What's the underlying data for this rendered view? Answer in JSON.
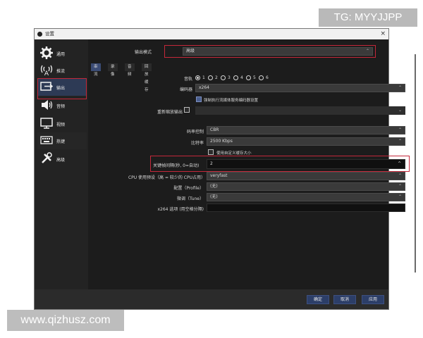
{
  "watermarks": {
    "top": "TG: MYYJJPP",
    "bottom": "www.qizhusz.com"
  },
  "window": {
    "title": "设置",
    "close_glyph": "×"
  },
  "sidebar": {
    "items": [
      {
        "label": "通用",
        "icon": "gear-icon"
      },
      {
        "label": "推流",
        "icon": "broadcast-icon"
      },
      {
        "label": "输出",
        "icon": "output-icon"
      },
      {
        "label": "音频",
        "icon": "speaker-icon"
      },
      {
        "label": "视频",
        "icon": "monitor-icon"
      },
      {
        "label": "热键",
        "icon": "keyboard-icon"
      },
      {
        "label": "高级",
        "icon": "tools-icon"
      }
    ],
    "active": "输出"
  },
  "output_mode": {
    "label": "输出模式",
    "value": "高级"
  },
  "tabs": [
    {
      "label": "串流"
    },
    {
      "label": "录像"
    },
    {
      "label": "音频"
    },
    {
      "label": "回放缓存"
    }
  ],
  "audio_track": {
    "label": "音轨",
    "options": [
      "1",
      "2",
      "3",
      "4",
      "5",
      "6"
    ],
    "selected": "1"
  },
  "encoder": {
    "label": "编码器",
    "value": "x264"
  },
  "enforce_checkbox": {
    "label": "强制执行流媒体服务编码器设置",
    "checked": true
  },
  "rescale": {
    "label": "重新缩放输出",
    "checked": false
  },
  "rate_control": {
    "label": "码率控制",
    "value": "CBR"
  },
  "bitrate": {
    "label": "比特率",
    "value": "2500 Kbps"
  },
  "custom_buffer": {
    "label": "使用自定义缓存大小",
    "checked": false
  },
  "keyframe": {
    "label": "关键帧间隔(秒, 0=自动)",
    "value": "2"
  },
  "cpu_preset": {
    "label": "CPU 使用预设（高 = 较少的 CPU占用）",
    "value": "veryfast"
  },
  "profile": {
    "label": "配置（Profile）",
    "value": "(无)"
  },
  "tune": {
    "label": "微调（Tune）",
    "value": "(无)"
  },
  "x264_opts": {
    "label": "x264 选项 (用空格分隔)",
    "value": ""
  },
  "footer": {
    "ok": "确定",
    "cancel": "取消",
    "apply": "应用"
  },
  "colors": {
    "highlight": "#c4283a",
    "accent": "#2c3e68"
  }
}
